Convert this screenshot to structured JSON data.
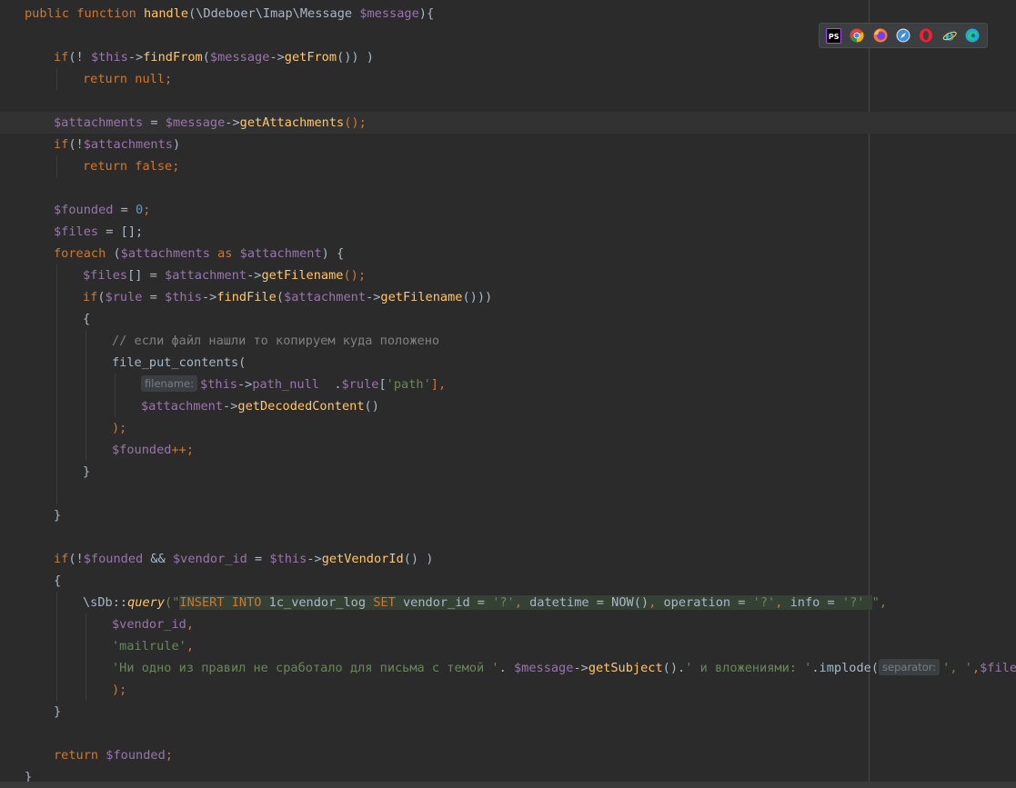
{
  "editor": {
    "lines": [
      {
        "indent": 0,
        "tokens": [
          {
            "t": "public function ",
            "c": "kw"
          },
          {
            "t": "handle",
            "c": "fn"
          },
          {
            "t": "(\\Ddeboer\\Imap\\Message ",
            "c": "plain"
          },
          {
            "t": "$message",
            "c": "var"
          },
          {
            "t": "){",
            "c": "plain"
          }
        ]
      },
      {
        "indent": 1,
        "tokens": []
      },
      {
        "indent": 1,
        "tokens": [
          {
            "t": "if",
            "c": "kw"
          },
          {
            "t": "(! ",
            "c": "plain"
          },
          {
            "t": "$this",
            "c": "var"
          },
          {
            "t": "->",
            "c": "plain"
          },
          {
            "t": "findFrom",
            "c": "fn"
          },
          {
            "t": "(",
            "c": "plain"
          },
          {
            "t": "$message",
            "c": "var"
          },
          {
            "t": "->",
            "c": "plain"
          },
          {
            "t": "getFrom",
            "c": "fn"
          },
          {
            "t": "()) )",
            "c": "plain"
          }
        ]
      },
      {
        "indent": 2,
        "tokens": [
          {
            "t": "return null;",
            "c": "kw"
          }
        ]
      },
      {
        "indent": 1,
        "tokens": []
      },
      {
        "indent": 1,
        "current": true,
        "tokens": [
          {
            "t": "$attachments",
            "c": "var"
          },
          {
            "t": " = ",
            "c": "plain"
          },
          {
            "t": "$message",
            "c": "var"
          },
          {
            "t": "->",
            "c": "plain"
          },
          {
            "t": "getAttachments",
            "c": "fn"
          },
          {
            "t": "();",
            "c": "kw"
          }
        ]
      },
      {
        "indent": 1,
        "tokens": [
          {
            "t": "if",
            "c": "kw"
          },
          {
            "t": "(!",
            "c": "plain"
          },
          {
            "t": "$attachments",
            "c": "var"
          },
          {
            "t": ")",
            "c": "plain"
          }
        ]
      },
      {
        "indent": 2,
        "tokens": [
          {
            "t": "return false;",
            "c": "kw"
          }
        ]
      },
      {
        "indent": 1,
        "tokens": []
      },
      {
        "indent": 1,
        "tokens": [
          {
            "t": "$founded",
            "c": "var"
          },
          {
            "t": " = ",
            "c": "plain"
          },
          {
            "t": "0",
            "c": "num"
          },
          {
            "t": ";",
            "c": "kw"
          }
        ]
      },
      {
        "indent": 1,
        "tokens": [
          {
            "t": "$files",
            "c": "var"
          },
          {
            "t": " = [];",
            "c": "plain"
          }
        ]
      },
      {
        "indent": 1,
        "tokens": [
          {
            "t": "foreach ",
            "c": "kw"
          },
          {
            "t": "(",
            "c": "plain"
          },
          {
            "t": "$attachments",
            "c": "var"
          },
          {
            "t": " as ",
            "c": "kw"
          },
          {
            "t": "$attachment",
            "c": "var"
          },
          {
            "t": ") {",
            "c": "plain"
          }
        ]
      },
      {
        "indent": 2,
        "tokens": [
          {
            "t": "$files",
            "c": "var"
          },
          {
            "t": "[] = ",
            "c": "plain"
          },
          {
            "t": "$attachment",
            "c": "var"
          },
          {
            "t": "->",
            "c": "plain"
          },
          {
            "t": "getFilename",
            "c": "fn"
          },
          {
            "t": "();",
            "c": "kw"
          }
        ]
      },
      {
        "indent": 2,
        "tokens": [
          {
            "t": "if",
            "c": "kw"
          },
          {
            "t": "(",
            "c": "plain"
          },
          {
            "t": "$rule",
            "c": "var"
          },
          {
            "t": " = ",
            "c": "plain"
          },
          {
            "t": "$this",
            "c": "var"
          },
          {
            "t": "->",
            "c": "plain"
          },
          {
            "t": "findFile",
            "c": "fn"
          },
          {
            "t": "(",
            "c": "plain"
          },
          {
            "t": "$attachment",
            "c": "var"
          },
          {
            "t": "->",
            "c": "plain"
          },
          {
            "t": "getFilename",
            "c": "fn"
          },
          {
            "t": "()))",
            "c": "plain"
          }
        ]
      },
      {
        "indent": 2,
        "tokens": [
          {
            "t": "{",
            "c": "plain"
          }
        ]
      },
      {
        "indent": 3,
        "tokens": [
          {
            "t": "// если файл нашли то копируем куда положено",
            "c": "cmt"
          }
        ]
      },
      {
        "indent": 3,
        "tokens": [
          {
            "t": "file_put_contents(",
            "c": "plain"
          }
        ]
      },
      {
        "indent": 4,
        "tokens": [
          {
            "hint": "filename:"
          },
          {
            "t": "$this",
            "c": "var"
          },
          {
            "t": "->",
            "c": "plain"
          },
          {
            "t": "path_null",
            "c": "var"
          },
          {
            "t": "  .",
            "c": "plain"
          },
          {
            "t": "$rule",
            "c": "var"
          },
          {
            "t": "[",
            "c": "plain"
          },
          {
            "t": "'path'",
            "c": "str"
          },
          {
            "t": "],",
            "c": "kw"
          }
        ]
      },
      {
        "indent": 4,
        "tokens": [
          {
            "t": "$attachment",
            "c": "var"
          },
          {
            "t": "->",
            "c": "plain"
          },
          {
            "t": "getDecodedContent",
            "c": "fn"
          },
          {
            "t": "()",
            "c": "plain"
          }
        ]
      },
      {
        "indent": 3,
        "tokens": [
          {
            "t": ");",
            "c": "kw"
          }
        ]
      },
      {
        "indent": 3,
        "tokens": [
          {
            "t": "$founded",
            "c": "var"
          },
          {
            "t": "++;",
            "c": "kw"
          }
        ]
      },
      {
        "indent": 2,
        "tokens": [
          {
            "t": "}",
            "c": "plain"
          }
        ]
      },
      {
        "indent": 2,
        "tokens": []
      },
      {
        "indent": 1,
        "tokens": [
          {
            "t": "}",
            "c": "plain"
          }
        ]
      },
      {
        "indent": 1,
        "tokens": []
      },
      {
        "indent": 1,
        "tokens": [
          {
            "t": "if",
            "c": "kw"
          },
          {
            "t": "(!",
            "c": "plain"
          },
          {
            "t": "$founded",
            "c": "var"
          },
          {
            "t": " && ",
            "c": "plain"
          },
          {
            "t": "$vendor_id",
            "c": "var"
          },
          {
            "t": " = ",
            "c": "plain"
          },
          {
            "t": "$this",
            "c": "var"
          },
          {
            "t": "->",
            "c": "plain"
          },
          {
            "t": "getVendorId",
            "c": "fn"
          },
          {
            "t": "() )",
            "c": "plain"
          }
        ]
      },
      {
        "indent": 1,
        "tokens": [
          {
            "t": "{",
            "c": "plain"
          }
        ]
      },
      {
        "indent": 2,
        "tokens": [
          {
            "t": "\\sDb",
            "c": "plain"
          },
          {
            "t": "::",
            "c": "plain"
          },
          {
            "t": "query",
            "c": "it"
          },
          {
            "t": "(\"",
            "c": "str"
          },
          {
            "t": "INSERT INTO ",
            "c": "sqlkw",
            "bg": true
          },
          {
            "t": "1c_vendor_log ",
            "c": "sql",
            "bg": true
          },
          {
            "t": "SET ",
            "c": "sqlkw",
            "bg": true
          },
          {
            "t": "vendor_id = ",
            "c": "sql",
            "bg": true
          },
          {
            "t": "'?'",
            "c": "str",
            "bg": true
          },
          {
            "t": ", ",
            "c": "sqlkw",
            "bg": true
          },
          {
            "t": "datetime = NOW()",
            "c": "sql",
            "bg": true
          },
          {
            "t": ", ",
            "c": "sqlkw",
            "bg": true
          },
          {
            "t": "operation = ",
            "c": "sql",
            "bg": true
          },
          {
            "t": "'?'",
            "c": "str",
            "bg": true
          },
          {
            "t": ", ",
            "c": "sqlkw",
            "bg": true
          },
          {
            "t": "info = ",
            "c": "sql",
            "bg": true
          },
          {
            "t": "'?' ",
            "c": "str",
            "bg": true
          },
          {
            "t": "\",",
            "c": "str"
          }
        ]
      },
      {
        "indent": 3,
        "tokens": [
          {
            "t": "$vendor_id",
            "c": "var"
          },
          {
            "t": ",",
            "c": "kw"
          }
        ]
      },
      {
        "indent": 3,
        "tokens": [
          {
            "t": "'mailrule'",
            "c": "str"
          },
          {
            "t": ",",
            "c": "kw"
          }
        ]
      },
      {
        "indent": 3,
        "tokens": [
          {
            "t": "'Ни одно из правил не сработало для письма с темой '",
            "c": "str"
          },
          {
            "t": ". ",
            "c": "plain"
          },
          {
            "t": "$message",
            "c": "var"
          },
          {
            "t": "->",
            "c": "plain"
          },
          {
            "t": "getSubject",
            "c": "fn"
          },
          {
            "t": "().",
            "c": "plain"
          },
          {
            "t": "' и вложениями: '",
            "c": "str"
          },
          {
            "t": ".implode(",
            "c": "plain"
          },
          {
            "hint": "separator:"
          },
          {
            "t": "', '",
            "c": "str"
          },
          {
            "t": ",",
            "c": "kw"
          },
          {
            "t": "$files",
            "c": "var"
          }
        ]
      },
      {
        "indent": 3,
        "tokens": [
          {
            "t": ");",
            "c": "kw"
          }
        ]
      },
      {
        "indent": 1,
        "tokens": [
          {
            "t": "}",
            "c": "plain"
          }
        ]
      },
      {
        "indent": 1,
        "tokens": []
      },
      {
        "indent": 1,
        "tokens": [
          {
            "t": "return ",
            "c": "kw"
          },
          {
            "t": "$founded",
            "c": "var"
          },
          {
            "t": ";",
            "c": "kw"
          }
        ]
      },
      {
        "indent": 0,
        "tokens": [
          {
            "t": "}",
            "c": "plain"
          }
        ]
      }
    ]
  },
  "browser_toolbar": {
    "icons": [
      {
        "name": "phpstorm-icon",
        "label": "PS",
        "color": "#000000"
      },
      {
        "name": "chrome-icon",
        "color": "#4285f4"
      },
      {
        "name": "firefox-icon",
        "color": "#ff7139"
      },
      {
        "name": "safari-icon",
        "color": "#3d8fe0"
      },
      {
        "name": "opera-icon",
        "color": "#ff1b2d"
      },
      {
        "name": "ie-icon",
        "color": "#1ebbee"
      },
      {
        "name": "edge-icon",
        "color": "#1fa8d8"
      }
    ]
  }
}
